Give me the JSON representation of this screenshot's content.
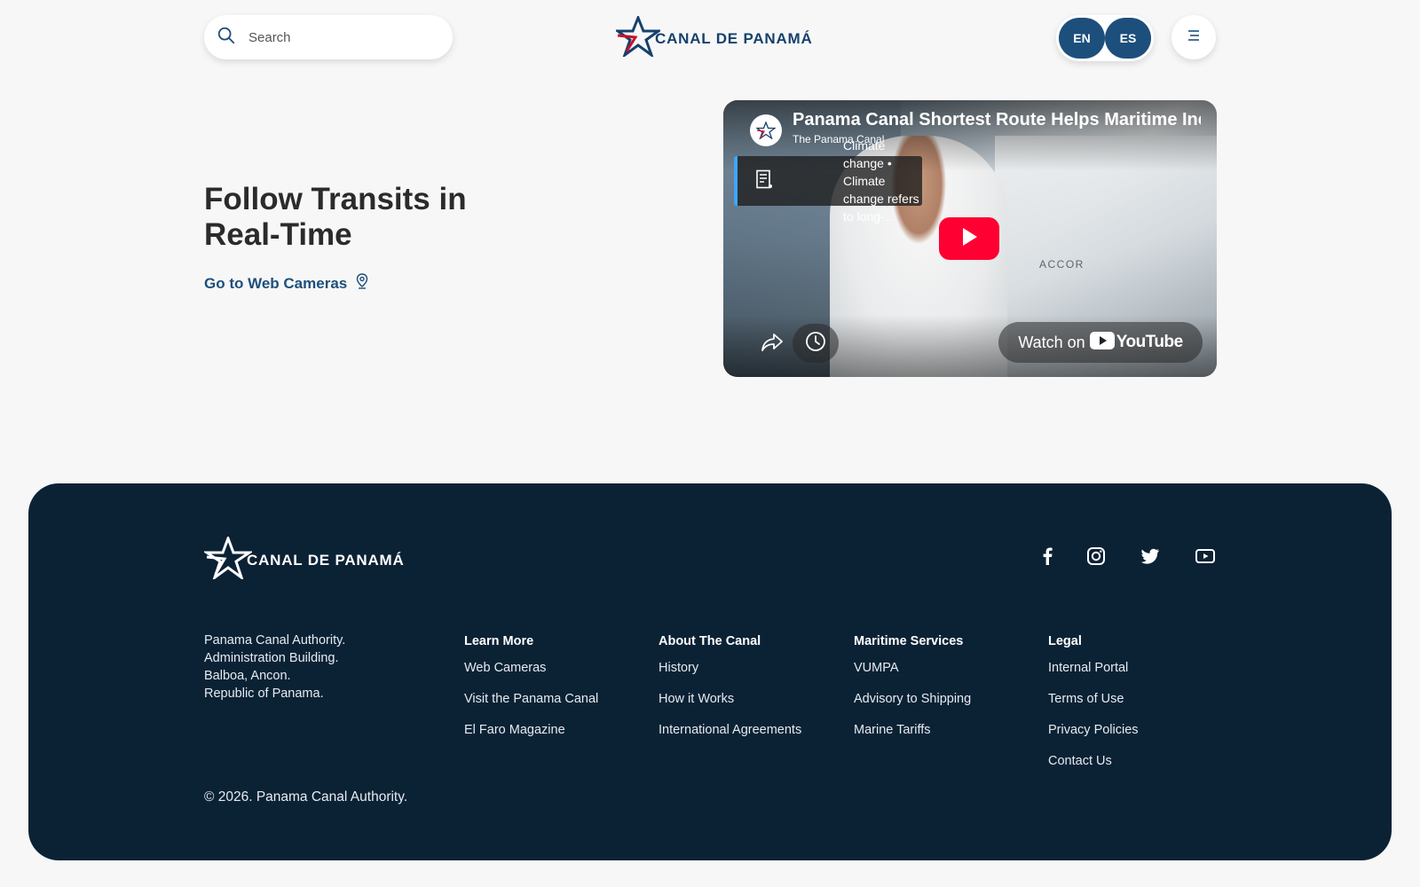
{
  "header": {
    "search_placeholder": "Search",
    "logo_text": "CANAL DE PANAMÁ",
    "lang_en": "EN",
    "lang_es": "ES"
  },
  "hero": {
    "title": "Follow Transits in Real-Time",
    "link": "Go to Web Cameras"
  },
  "video": {
    "title": "Panama Canal Shortest Route Helps Maritime Inc",
    "channel": "The Panama Canal",
    "card_text": "Climate change • Climate change refers to long-...",
    "watch_on": "Watch on",
    "youtube": "YouTube",
    "overlay_text": "ACCOR"
  },
  "footer": {
    "logo_text": "CANAL DE PANAMÁ",
    "address": [
      "Panama Canal Authority.",
      "Administration Building.",
      "Balboa, Ancon.",
      "Republic of Panama."
    ],
    "columns": [
      {
        "title": "Learn More",
        "links": [
          "Web Cameras",
          "Visit the Panama Canal",
          "El Faro Magazine"
        ]
      },
      {
        "title": "About The Canal",
        "links": [
          "History",
          "How it Works",
          "International Agreements"
        ]
      },
      {
        "title": "Maritime Services",
        "links": [
          "VUMPA",
          "Advisory to Shipping",
          "Marine Tariffs"
        ]
      },
      {
        "title": "Legal",
        "links": [
          "Internal Portal",
          "Terms of Use",
          "Privacy Policies",
          "Contact Us"
        ]
      }
    ],
    "copyright": "© 2026. Panama Canal Authority.",
    "social_icons": [
      "facebook-icon",
      "instagram-icon",
      "twitter-icon",
      "youtube-icon"
    ]
  },
  "colors": {
    "brand_blue": "#1d4f7c",
    "brand_red": "#c8102e",
    "footer_bg": "#0b2235",
    "youtube_red": "#ff0033"
  }
}
